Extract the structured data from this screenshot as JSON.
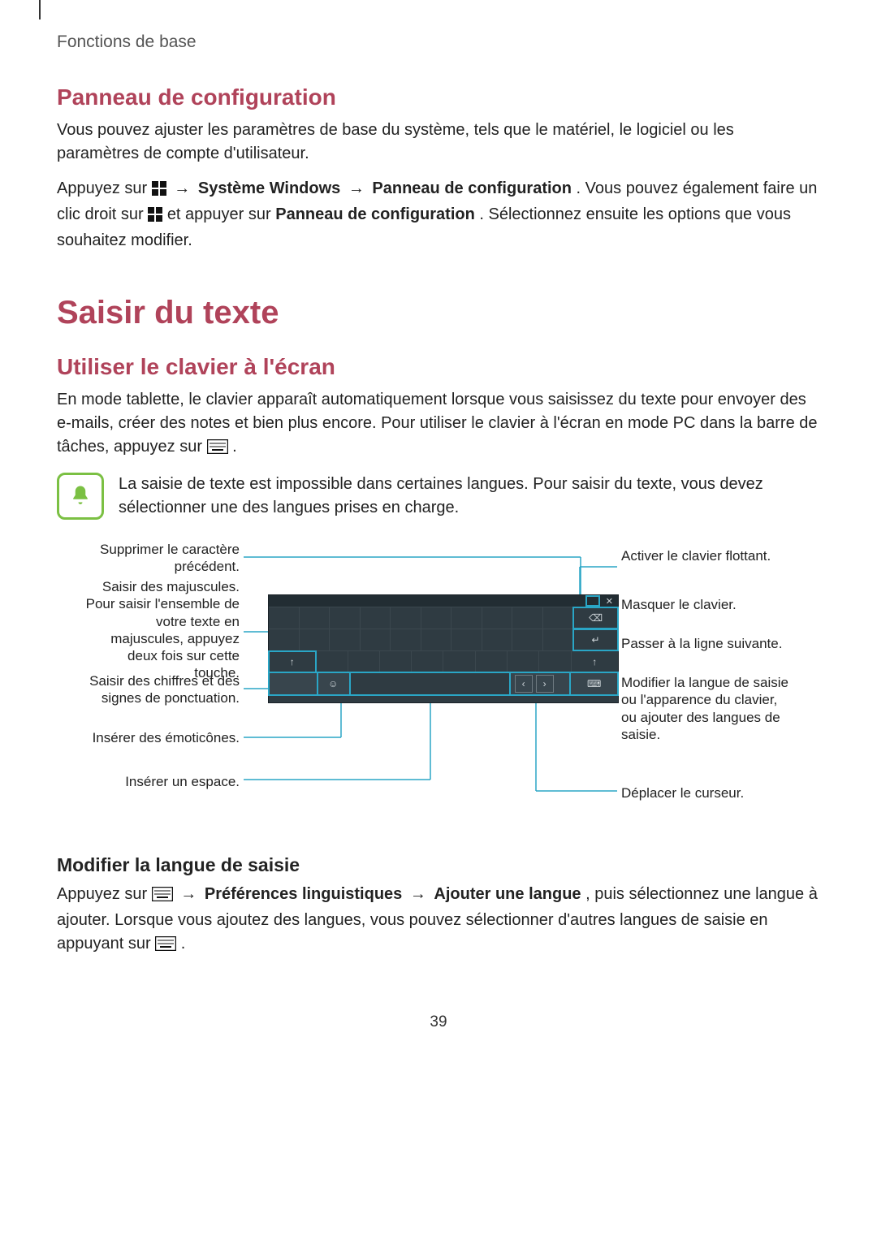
{
  "breadcrumb": "Fonctions de base",
  "page_num": "39",
  "sec1": {
    "title": "Panneau de configuration",
    "p1": "Vous pouvez ajuster les paramètres de base du système, tels que le matériel, le logiciel ou les paramètres de compte d'utilisateur.",
    "p2a": "Appuyez sur ",
    "p2b": " → ",
    "p2_sys": "Système Windows",
    "p2c": " → ",
    "p2_panel": "Panneau de configuration",
    "p2d": ". Vous pouvez également faire un clic droit sur ",
    "p2e": " et appuyer sur ",
    "p2_panel2": "Panneau de configuration",
    "p2f": ". Sélectionnez ensuite les options que vous souhaitez modifier."
  },
  "sec2": {
    "title": "Saisir du texte",
    "sub1": "Utiliser le clavier à l'écran",
    "p1a": "En mode tablette, le clavier apparaît automatiquement lorsque vous saisissez du texte pour envoyer des e-mails, créer des notes et bien plus encore. Pour utiliser le clavier à l'écran en mode PC dans la barre de tâches, appuyez sur ",
    "p1b": ".",
    "note": "La saisie de texte est impossible dans certaines langues. Pour saisir du texte, vous devez sélectionner une des langues prises en charge."
  },
  "callouts": {
    "l1": "Supprimer le caractère précédent.",
    "l2": "Saisir des majuscules. Pour saisir l'ensemble de votre texte en majuscules, appuyez deux fois sur cette touche.",
    "l3": "Saisir des chiffres et des signes de ponctuation.",
    "l4": "Insérer des émoticônes.",
    "l5": "Insérer un espace.",
    "r1": "Activer le clavier flottant.",
    "r2": "Masquer le clavier.",
    "r3": "Passer à la ligne suivante.",
    "r4": "Modifier la langue de saisie ou l'apparence du clavier, ou ajouter des langues de saisie.",
    "r5": "Déplacer le curseur."
  },
  "sec3": {
    "title": "Modifier la langue de saisie",
    "p1a": "Appuyez sur ",
    "p1b": " → ",
    "p1_pref": "Préférences linguistiques",
    "p1c": " → ",
    "p1_add": "Ajouter une langue",
    "p1d": ", puis sélectionnez une langue à ajouter. Lorsque vous ajoutez des langues, vous pouvez sélectionner d'autres langues de saisie en appuyant sur ",
    "p1e": "."
  }
}
